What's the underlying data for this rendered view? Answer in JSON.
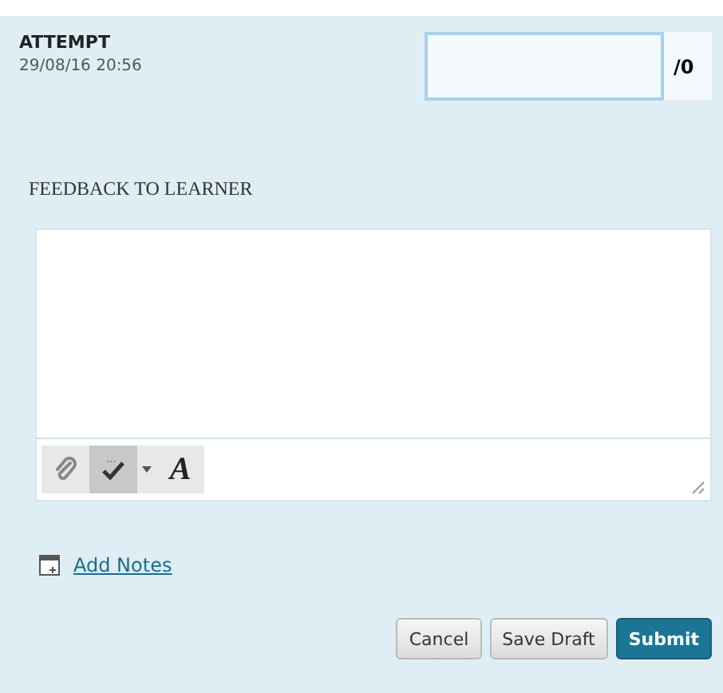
{
  "attempt": {
    "label": "ATTEMPT",
    "date": "29/08/16 20:56"
  },
  "score": {
    "max": "/0"
  },
  "feedback": {
    "label": "FEEDBACK TO LEARNER"
  },
  "toolbar": [
    {
      "kind": "attach",
      "pressed": false
    },
    {
      "kind": "spellcheck",
      "pressed": true
    },
    {
      "kind": "dropdown",
      "pressed": false
    },
    {
      "kind": "format",
      "pressed": false,
      "label": "A"
    }
  ],
  "notes_link": "Add Notes",
  "buttons": [
    {
      "label": "Cancel",
      "kind": "secondary"
    },
    {
      "label": "Save Draft",
      "kind": "secondary"
    },
    {
      "label": "Submit",
      "kind": "primary"
    }
  ]
}
